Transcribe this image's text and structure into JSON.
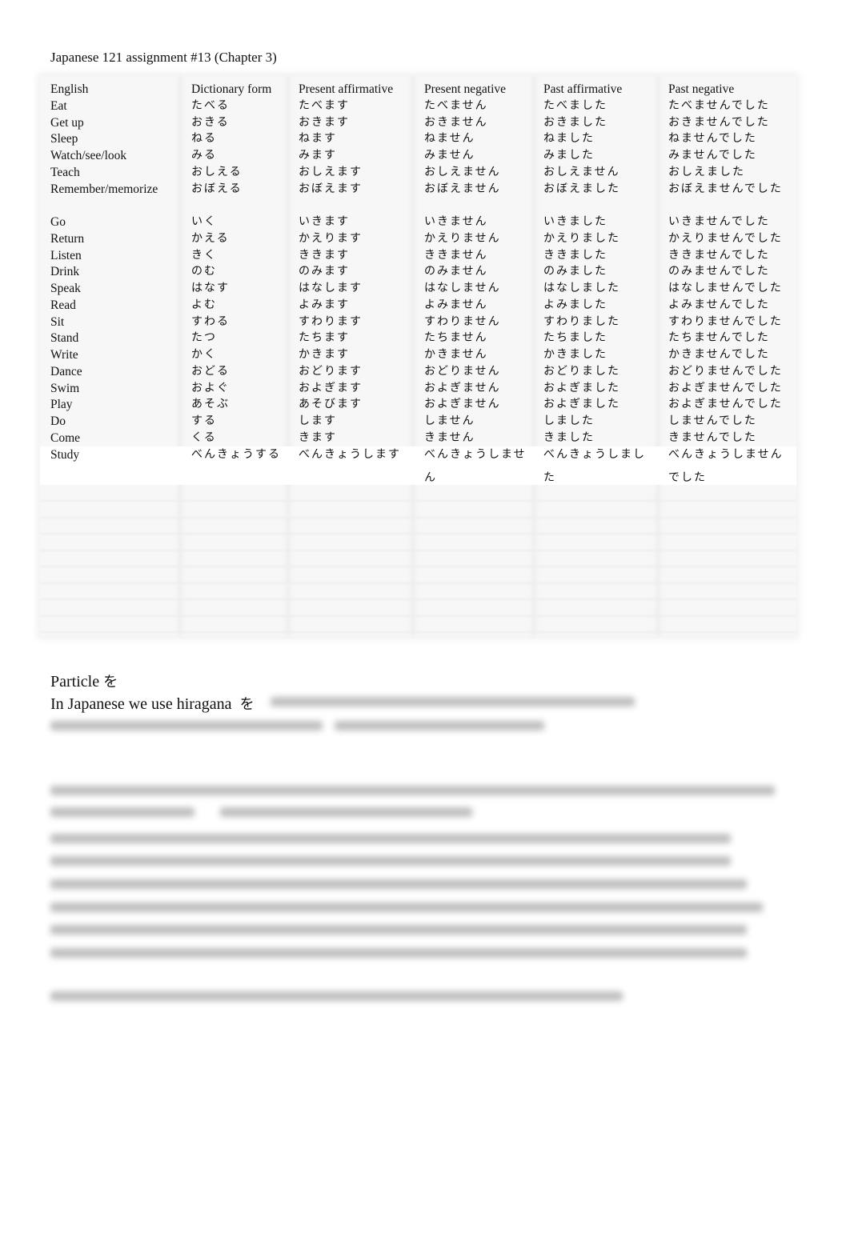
{
  "title": "Japanese 121 assignment #13 (Chapter 3)",
  "table": {
    "headers": [
      "English",
      "Dictionary form",
      "Present affirmative",
      "Present negative",
      "Past affirmative",
      "Past negative"
    ],
    "rows": [
      [
        "Eat",
        "たべる",
        "たべます",
        "たべません",
        "たべました",
        "たべませんでした"
      ],
      [
        "Get up",
        "おきる",
        "おきます",
        "おきません",
        "おきました",
        "おきませんでした"
      ],
      [
        "Sleep",
        "ねる",
        "ねます",
        "ねません",
        "ねました",
        "ねませんでした"
      ],
      [
        "Watch/see/look",
        "みる",
        "みます",
        "みません",
        "みました",
        "みませんでした"
      ],
      [
        "Teach",
        "おしえる",
        "おしえます",
        "おしえません",
        "おしえません",
        "おしえました"
      ],
      [
        "Remember/memorize",
        "おぼえる",
        "おぼえます",
        "おぼえません",
        "おぼえました",
        "おぼえませんでした"
      ],
      [
        "",
        "",
        "",
        "",
        "",
        ""
      ],
      [
        "Go",
        "いく",
        "いきます",
        "いきません",
        "いきました",
        "いきませんでした"
      ],
      [
        "Return",
        "かえる",
        "かえります",
        "かえりません",
        "かえりました",
        "かえりませんでした"
      ],
      [
        "Listen",
        "きく",
        "ききます",
        "ききません",
        "ききました",
        "ききませんでした"
      ],
      [
        "Drink",
        "のむ",
        "のみます",
        "のみません",
        "のみました",
        "のみませんでした"
      ],
      [
        "Speak",
        "はなす",
        "はなします",
        "はなしません",
        "はなしました",
        "はなしませんでした"
      ],
      [
        "Read",
        "よむ",
        "よみます",
        "よみません",
        "よみました",
        "よみませんでした"
      ],
      [
        "Sit",
        "すわる",
        "すわります",
        "すわりません",
        "すわりました",
        "すわりませんでした"
      ],
      [
        "Stand",
        "たつ",
        "たちます",
        "たちません",
        "たちました",
        "たちませんでした"
      ],
      [
        "Write",
        "かく",
        "かきます",
        "かきません",
        "かきました",
        "かきませんでした"
      ],
      [
        "Dance",
        "おどる",
        "おどります",
        "おどりません",
        "おどりました",
        "おどりませんでした"
      ],
      [
        "Swim",
        "およぐ",
        "およぎます",
        "およぎません",
        "およぎました",
        "およぎませんでした"
      ],
      [
        "Play",
        "あそぶ",
        "あそびます",
        "およぎません",
        "およぎました",
        "およぎませんでした"
      ],
      [
        "Do",
        "する",
        "します",
        "しません",
        "しました",
        "しませんでした"
      ],
      [
        "Come",
        "くる",
        "きます",
        "きません",
        "きました",
        "きませんでした"
      ],
      [
        "Study",
        "べんきょうする",
        "べんきょうします",
        "べんきょうしません",
        "べんきょうしました",
        "べんきょうしませんでした"
      ]
    ]
  },
  "particle": {
    "heading": "Particle",
    "heading_kana": "を",
    "line": "In Japanese we use hiragana",
    "line_kana": "を"
  }
}
